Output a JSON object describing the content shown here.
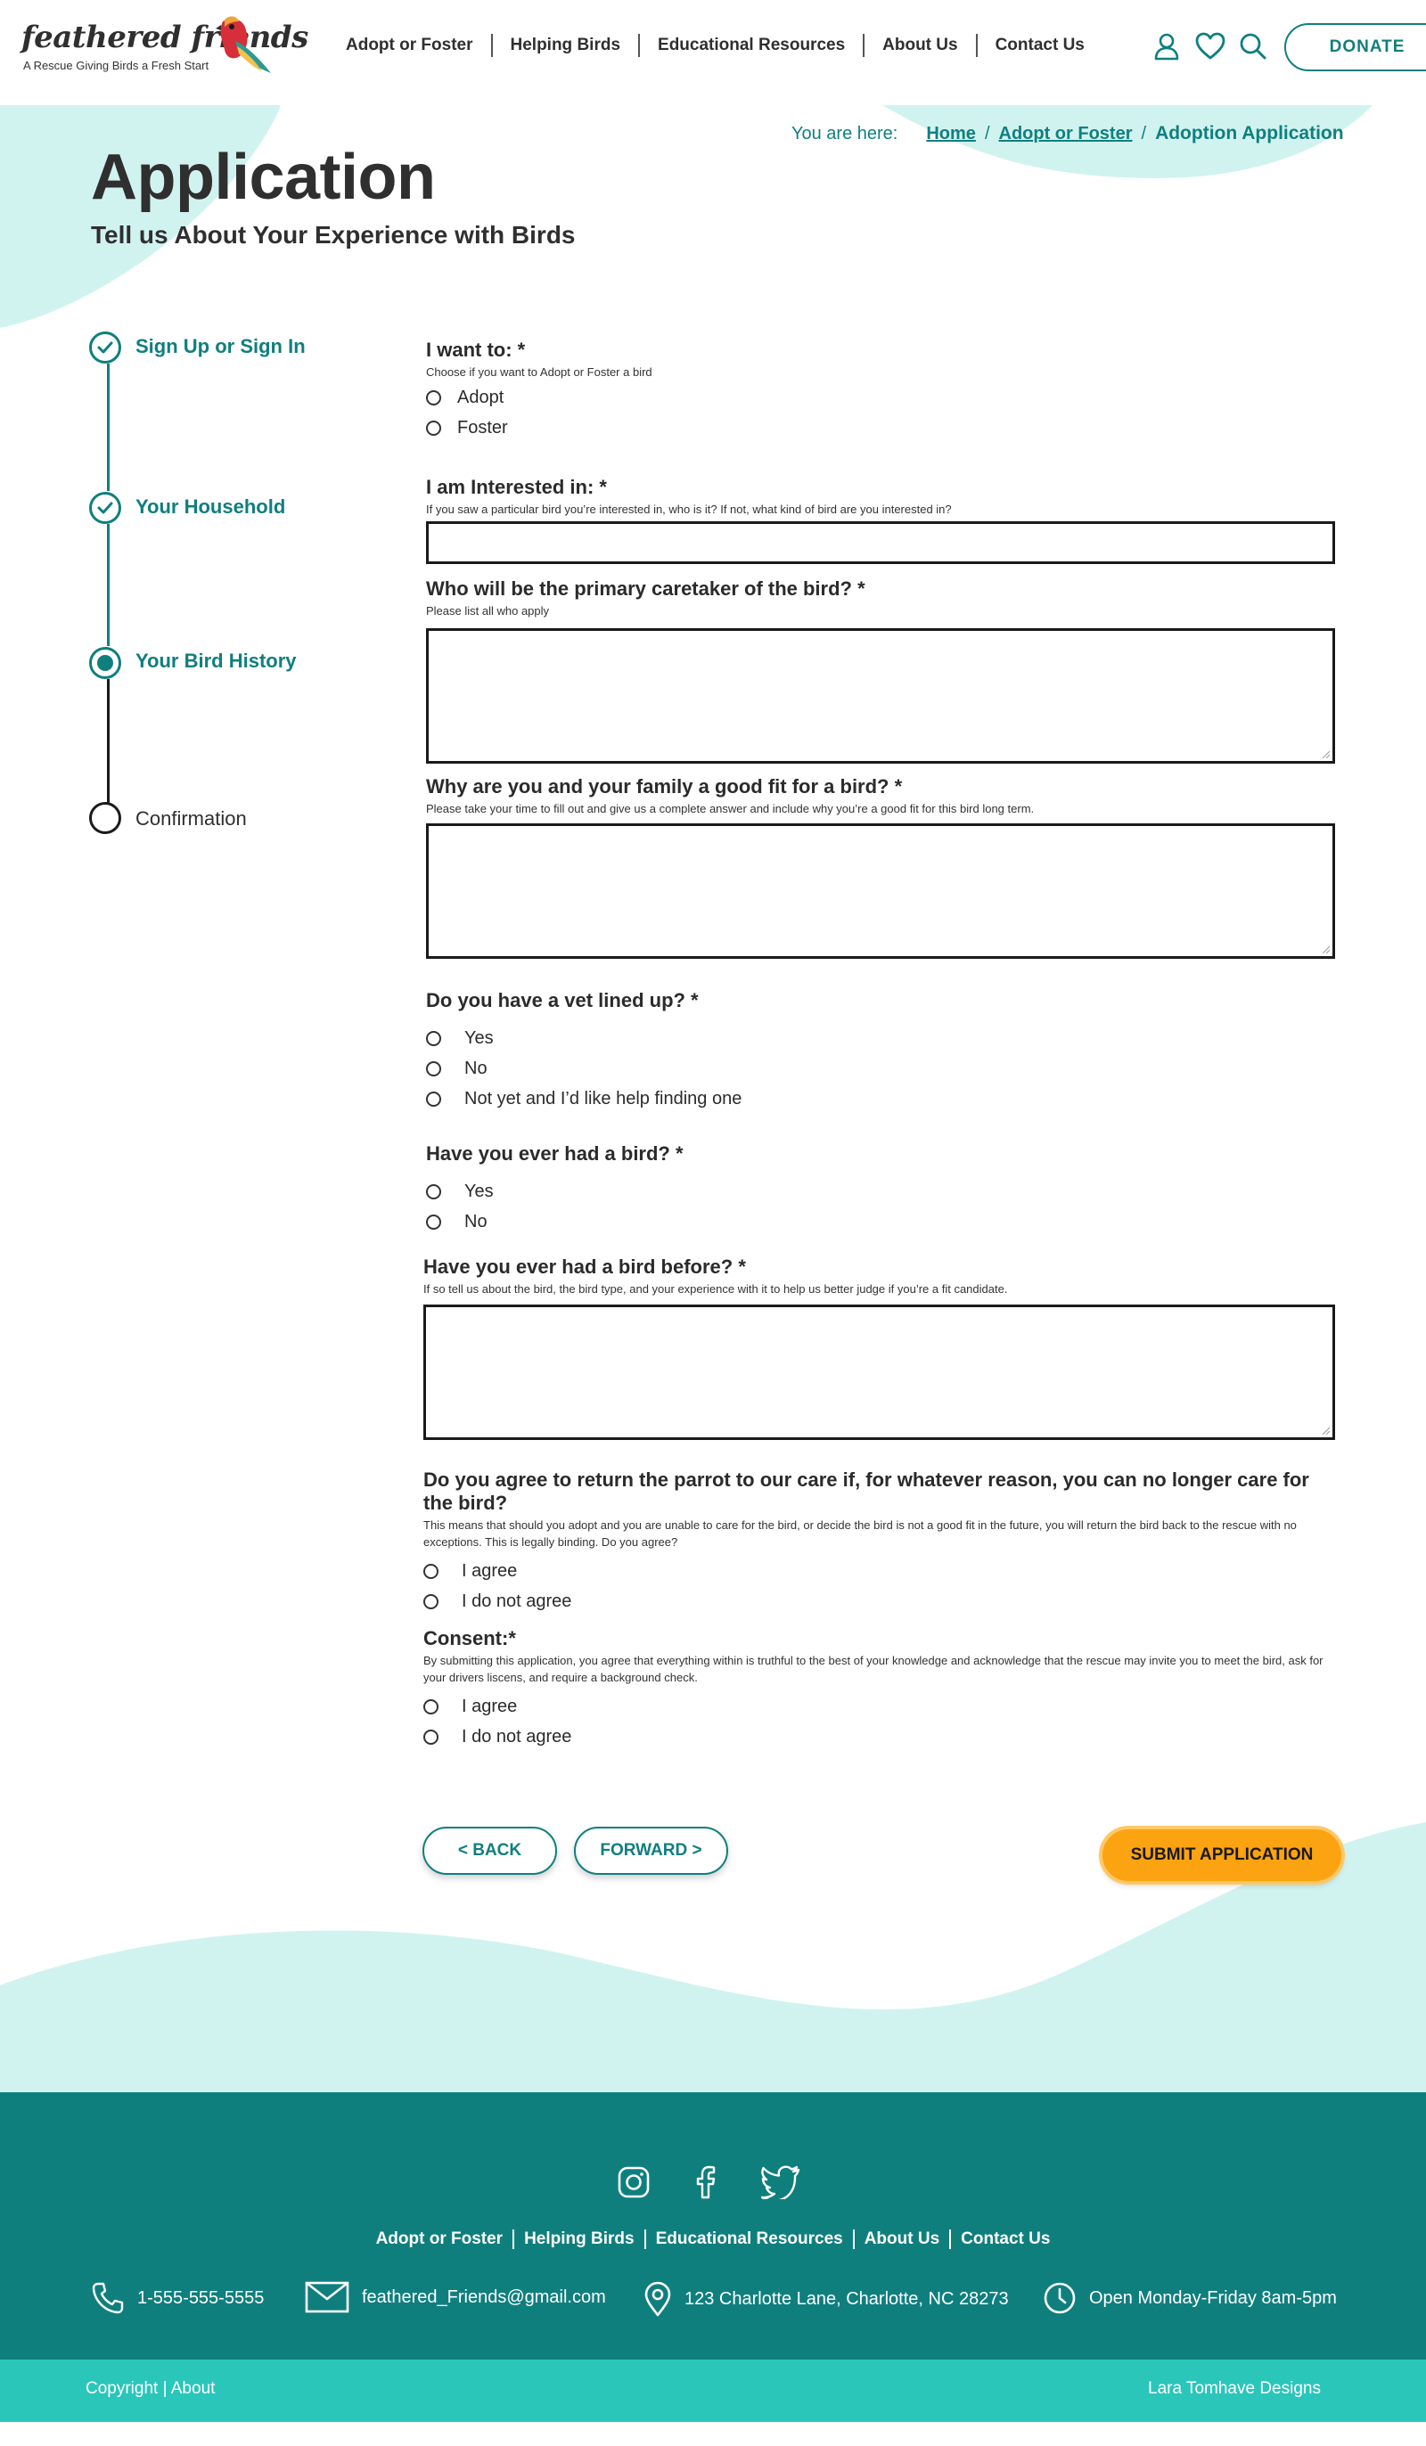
{
  "brand": {
    "name": "feathered friends",
    "tagline": "A Rescue Giving Birds a Fresh Start"
  },
  "nav": [
    "Adopt or Foster",
    "Helping Birds",
    "Educational Resources",
    "About Us",
    "Contact Us"
  ],
  "header_icons": [
    "user-icon",
    "heart-icon",
    "search-icon"
  ],
  "donate_label": "DONATE",
  "breadcrumb": {
    "label": "You are here:",
    "items": [
      "Home",
      "Adopt or Foster",
      "Adoption Application"
    ]
  },
  "page": {
    "title": "Application",
    "subtitle": "Tell us About Your Experience with Birds"
  },
  "steps": [
    {
      "label": "Sign Up or Sign In",
      "state": "complete"
    },
    {
      "label": "Your Household",
      "state": "complete"
    },
    {
      "label": "Your Bird History",
      "state": "current"
    },
    {
      "label": "Confirmation",
      "state": "upcoming"
    }
  ],
  "form": {
    "q1": {
      "label": "I want to: *",
      "help": "Choose if you want to Adopt or Foster a bird",
      "options": [
        "Adopt",
        "Foster"
      ]
    },
    "q2": {
      "label": "I am Interested in: *",
      "help": "If you saw a particular bird you’re interested in, who is it? If not, what kind of bird are you interested in?",
      "value": ""
    },
    "q3": {
      "label": "Who will be the primary caretaker of the bird?  *",
      "help": "Please list all who apply",
      "value": ""
    },
    "q4": {
      "label": "Why are you and your family a good fit for a bird?  *",
      "help": "Please take your time to fill out and give us a complete answer and include why you’re a good fit for this bird long term.",
      "value": ""
    },
    "q5": {
      "label": "Do you have a vet lined up? *",
      "options": [
        "Yes",
        "No",
        "Not yet and I’d like help finding one"
      ]
    },
    "q6": {
      "label": "Have you ever had a bird? *",
      "options": [
        "Yes",
        "No"
      ]
    },
    "q7": {
      "label": "Have you ever had a bird before? *",
      "help": "If so tell us about the bird, the bird type, and your experience with it to help us better judge if you’re a fit candidate.",
      "value": ""
    },
    "q8": {
      "label": "Do you agree to return the parrot to our care if, for whatever reason, you can no longer care for the bird?",
      "help": "This means that should you adopt and you are unable to care for the bird, or decide the bird is not a good fit in the future, you will return the bird back to the rescue with no exceptions. This is legally binding. Do you agree?",
      "options": [
        "I agree",
        "I do not agree"
      ]
    },
    "q9": {
      "label": "Consent:*",
      "help": "By submitting this application, you agree that everything within is truthful to the best of your knowledge and acknowledge that the rescue may invite you to meet the bird, ask for your drivers liscens, and require a background check.",
      "options": [
        "I agree",
        "I do not agree"
      ]
    }
  },
  "buttons": {
    "back": "< BACK",
    "forward": "FORWARD >",
    "submit": "SUBMIT APPLICATION"
  },
  "footer": {
    "social": [
      "instagram-icon",
      "facebook-icon",
      "twitter-icon"
    ],
    "nav": [
      "Adopt or Foster",
      "Helping Birds",
      "Educational Resources",
      "About Us",
      "Contact Us"
    ],
    "phone": "1-555-555-5555",
    "email": "feathered_Friends@gmail.com",
    "address": "123 Charlotte Lane, Charlotte, NC 28273",
    "hours": "Open Monday-Friday 8am-5pm",
    "copyright": "Copyright | About",
    "designer": "Lara Tomhave Designs"
  },
  "colors": {
    "teal": "#0f7f7e",
    "light_teal": "#d1f3f0",
    "footer_bottom": "#2ac6ba",
    "submit": "#fca311"
  }
}
